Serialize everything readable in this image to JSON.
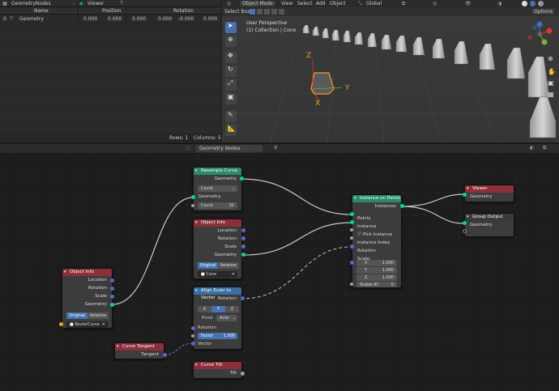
{
  "spreadsheet": {
    "object_label": "GeometryNodes",
    "viewer_label": "Viewer",
    "columns": [
      "Name",
      "Position",
      "Rotation"
    ],
    "row": {
      "index": "0",
      "name": "Geometry",
      "values": [
        "0.000",
        "0.000",
        "0.000",
        "0.000",
        "-0.000",
        "0.000"
      ]
    },
    "footer": {
      "rows": "Rows: 1",
      "columns": "Columns: 5"
    }
  },
  "viewport": {
    "mode": "Object Mode",
    "menus": [
      "View",
      "Select",
      "Add",
      "Object"
    ],
    "orientation": "Global",
    "select_box": "Select Box",
    "options": "Options",
    "perspective": "User Perspective",
    "collection": "(1) Collection | Cone",
    "axes": {
      "x": "X",
      "y": "Y",
      "z": "Z"
    }
  },
  "node_editor": {
    "tree_name": "Geometry Nodes"
  },
  "nodes": {
    "resample_curve": {
      "title": "Resample Curve",
      "out_geometry": "Geometry",
      "mode": "Count",
      "in_geometry": "Geometry",
      "count_label": "Count",
      "count_value": "32"
    },
    "object_info_1": {
      "title": "Object Info",
      "location": "Location",
      "rotation": "Rotation",
      "scale": "Scale",
      "geometry": "Geometry",
      "original": "Original",
      "relative": "Relative",
      "object": "Cone"
    },
    "object_info_2": {
      "title": "Object Info",
      "location": "Location",
      "rotation": "Rotation",
      "scale": "Scale",
      "geometry": "Geometry",
      "original": "Original",
      "relative": "Relative",
      "object": "BezierCurve"
    },
    "align_euler": {
      "title": "Align Euler to Vector",
      "rotation_out": "Rotation",
      "axes": [
        "X",
        "Y",
        "Z"
      ],
      "pivot_label": "Pivot",
      "pivot_value": "Auto",
      "rotation_in": "Rotation",
      "factor_label": "Factor",
      "factor_value": "1.000",
      "vector": "Vector"
    },
    "instance_on_points": {
      "title": "Instance on Points",
      "instances": "Instances",
      "points": "Points",
      "instance": "Instance",
      "pick_instance": "Pick Instance",
      "instance_index": "Instance Index",
      "rotation": "Rotation",
      "scale": "Scale:",
      "x_label": "X",
      "x_value": "1.000",
      "y_label": "Y",
      "y_value": "1.000",
      "z_label": "Z",
      "z_value": "1.000",
      "stable_id_label": "Stable ID",
      "stable_id_value": "0"
    },
    "viewer": {
      "title": "Viewer",
      "geometry": "Geometry"
    },
    "group_output": {
      "title": "Group Output",
      "geometry": "Geometry"
    },
    "curve_tangent": {
      "title": "Curve Tangent",
      "tangent": "Tangent"
    },
    "curve_tilt": {
      "title": "Curve Tilt",
      "tilt": "Tilt"
    }
  }
}
